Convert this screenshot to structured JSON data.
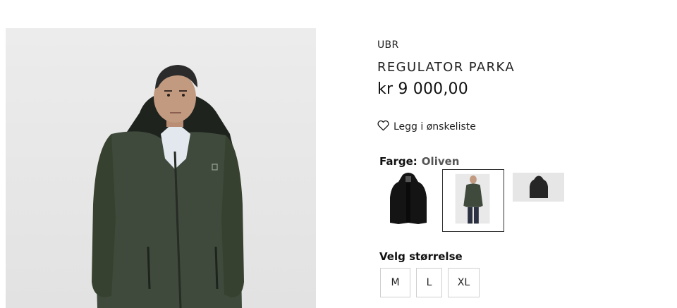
{
  "product": {
    "brand": "UBR",
    "title": "REGULATOR PARKA",
    "price": "kr 9 000,00",
    "image_alt": "model wearing olive parka"
  },
  "wishlist": {
    "label": "Legg i ønskeliste",
    "icon": "heart-icon"
  },
  "color": {
    "label": "Farge:",
    "value": "Oliven",
    "swatches": [
      {
        "name": "black",
        "color": "#1c1c1c",
        "selected": false
      },
      {
        "name": "olive",
        "color": "#3e4a3a",
        "selected": true
      },
      {
        "name": "grey",
        "color": "#2a2a2a",
        "selected": false
      }
    ]
  },
  "sizes": {
    "heading": "Velg størrelse",
    "options": [
      "M",
      "L",
      "XL"
    ]
  },
  "colors": {
    "jacket_olive": "#3f4a3c",
    "background_image": "#e8e8e8",
    "text": "#1a1a1a"
  }
}
